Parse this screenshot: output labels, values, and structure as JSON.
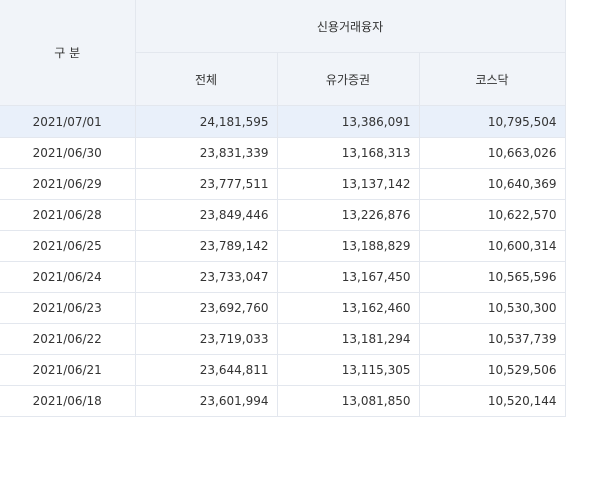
{
  "header": {
    "category": "구 분",
    "group": "신용거래융자",
    "columns": [
      "전체",
      "유가증권",
      "코스닥"
    ]
  },
  "rows": [
    {
      "date": "2021/07/01",
      "total": "24,181,595",
      "kospi": "13,386,091",
      "kosdaq": "10,795,504"
    },
    {
      "date": "2021/06/30",
      "total": "23,831,339",
      "kospi": "13,168,313",
      "kosdaq": "10,663,026"
    },
    {
      "date": "2021/06/29",
      "total": "23,777,511",
      "kospi": "13,137,142",
      "kosdaq": "10,640,369"
    },
    {
      "date": "2021/06/28",
      "total": "23,849,446",
      "kospi": "13,226,876",
      "kosdaq": "10,622,570"
    },
    {
      "date": "2021/06/25",
      "total": "23,789,142",
      "kospi": "13,188,829",
      "kosdaq": "10,600,314"
    },
    {
      "date": "2021/06/24",
      "total": "23,733,047",
      "kospi": "13,167,450",
      "kosdaq": "10,565,596"
    },
    {
      "date": "2021/06/23",
      "total": "23,692,760",
      "kospi": "13,162,460",
      "kosdaq": "10,530,300"
    },
    {
      "date": "2021/06/22",
      "total": "23,719,033",
      "kospi": "13,181,294",
      "kosdaq": "10,537,739"
    },
    {
      "date": "2021/06/21",
      "total": "23,644,811",
      "kospi": "13,115,305",
      "kosdaq": "10,529,506"
    },
    {
      "date": "2021/06/18",
      "total": "23,601,994",
      "kospi": "13,081,850",
      "kosdaq": "10,520,144"
    }
  ],
  "colors": {
    "header_bg": "#f1f4f9",
    "highlight_row": "#e9f0fa",
    "border": "#e3e7ee"
  }
}
